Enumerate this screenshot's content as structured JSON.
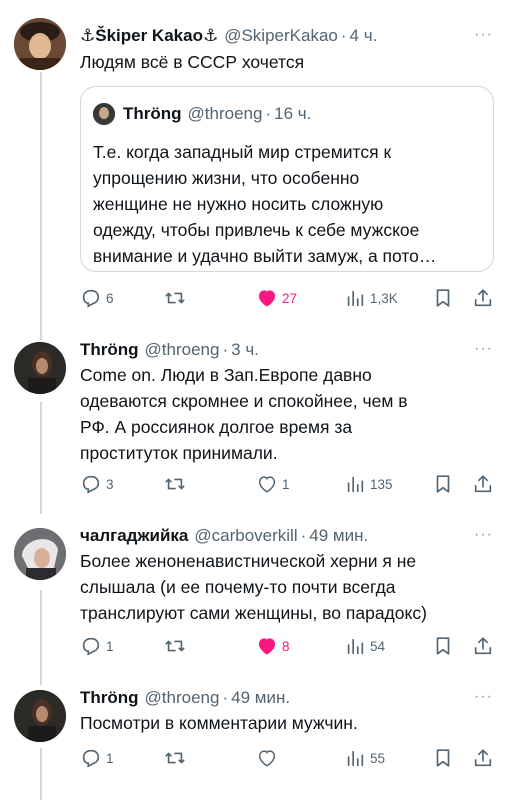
{
  "tweets": [
    {
      "name": "⚓Škiper Kakao⚓",
      "handle": "@SkiperKakao",
      "time": "4 ч.",
      "text": "Людям всё в СССР хочется",
      "replies": "6",
      "retweets": "",
      "likes": "27",
      "views": "1,3K",
      "liked": true
    },
    {
      "name": "Thröng",
      "handle": "@throeng",
      "time": "3 ч.",
      "text": "Come on. Люди в Зап.Европе давно\nодеваются скромнее и спокойнее, чем в\nРФ. А россиянок долгое время за\nпроституток принимали.",
      "replies": "3",
      "retweets": "",
      "likes": "1",
      "views": "135",
      "liked": false
    },
    {
      "name": "чалгаджийка",
      "handle": "@carboverkill",
      "time": "49 мин.",
      "text": "Более женоненавистнической херни я не\nслышала (и ее почему-то почти всегда\nтранслируют сами женщины, во парадокс)",
      "replies": "1",
      "retweets": "",
      "likes": "8",
      "views": "54",
      "liked": true
    },
    {
      "name": "Thröng",
      "handle": "@throeng",
      "time": "49 мин.",
      "text": "Посмотри в комментарии мужчин.",
      "replies": "1",
      "retweets": "",
      "likes": "",
      "views": "55",
      "liked": false
    }
  ],
  "quote": {
    "name": "Thröng",
    "handle": "@throeng",
    "time": "16 ч.",
    "text": "Т.е. когда западный мир стремится к\nупрощению жизни, что особенно\nженщине не нужно носить сложную\nодежду, чтобы привлечь к себе мужское\nвнимание и удачно выйти замуж, а пото…"
  },
  "ui": {
    "dot": "·",
    "more": "···"
  },
  "icons": [
    "reply-icon",
    "retweet-icon",
    "like-icon",
    "views-icon",
    "bookmark-icon",
    "share-icon",
    "more-icon"
  ],
  "colors": {
    "text": "#0f1419",
    "secondary": "#536471",
    "like": "#f91880",
    "border": "#cfd9de"
  }
}
